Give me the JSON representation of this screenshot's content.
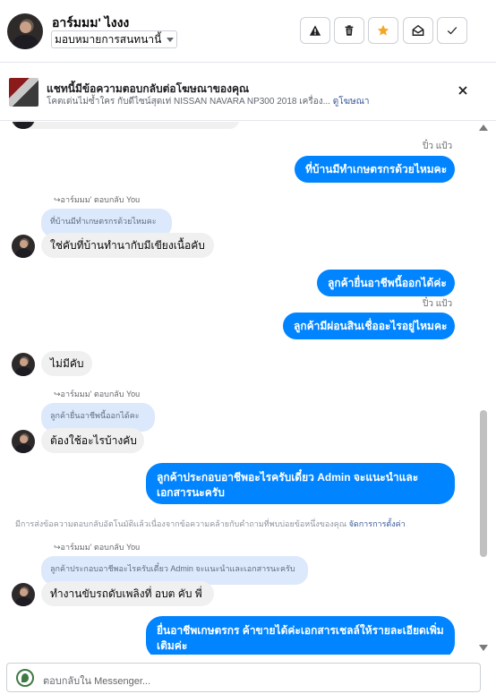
{
  "header": {
    "name": "อาร์มมม' ไงงง",
    "assign_label": "มอบหมายการสนทนานี้",
    "tools": [
      {
        "icon": "warning-icon"
      },
      {
        "icon": "trash-icon"
      },
      {
        "icon": "star-icon"
      },
      {
        "icon": "mark-unread-icon"
      },
      {
        "icon": "check-icon"
      }
    ]
  },
  "ad": {
    "title": "แชทนี้มีข้อความตอบกลับต่อโฆษณาของคุณ",
    "subtitle": "โคตเด่นไม่ซ้ำใคร กับดีไซน์สุดเท่ NISSAN NAVARA NP300 2018 เครื่อง...",
    "link": "ดูโฆษณา"
  },
  "messages": {
    "seen_1": "ปิ๋ว แป้ว",
    "out_1": "ที่บ้านมีทำเกษตรกรด้วยไหมคะ",
    "reply_label_1": "อาร์มมม' ตอบกลับ You",
    "quote_1": "ที่บ้านมีทำเกษตรกรด้วยไหมคะ",
    "in_1": "ใช่คับที่บ้านทำนากับมีเขียงเนื้อคับ",
    "out_2": "ลูกค้ายื่นอาชีพนี้ออกได้ค่ะ",
    "seen_2": "ปิ๋ว แป้ว",
    "out_3": "ลูกค้ามีผ่อนสินเชื่ออะไรอยู่ไหมคะ",
    "in_2": "ไม่มีคับ",
    "reply_label_2": "อาร์มมม' ตอบกลับ You",
    "quote_2": "ลูกค้ายื่นอาชีพนี้ออกได้คะ",
    "in_3": "ต้องใช้อะไรบ้างคับ",
    "out_4": "ลูกค้าประกอบอาชีพอะไรครับเดี๋ยว Admin จะแนะนำและเอกสารนะครับ",
    "auto_note": "มีการส่งข้อความตอบกลับอัตโนมัติแล้วเนื่องจากข้อความคล้ายกับคำถามที่พบบ่อยข้อหนึ่งของคุณ",
    "auto_note_link": "จัดการการตั้งค่า",
    "reply_label_3": "อาร์มมม' ตอบกลับ You",
    "quote_3": "ลูกค้าประกอบอาชีพอะไรครับเดี๋ยว Admin จะแนะนำและเอกสารนะครับ",
    "in_4": "ทำงานขับรถดับเพลิงที่ อบต คับ พี่",
    "out_5": "ยื่นอาชีพเกษตรกร ค้าขายได้ค่ะเอกสารเชลล์ให้รายละเอียดเพิ่มเติมค่ะ"
  },
  "composer": {
    "placeholder": "ตอบกลับใน Messenger..."
  },
  "colors": {
    "outgoing_bubble": "#0084ff",
    "incoming_bubble": "#f0f0f0",
    "quoted_bubble": "#dce8fb",
    "star_accent": "#f5a623",
    "link": "#385898"
  }
}
